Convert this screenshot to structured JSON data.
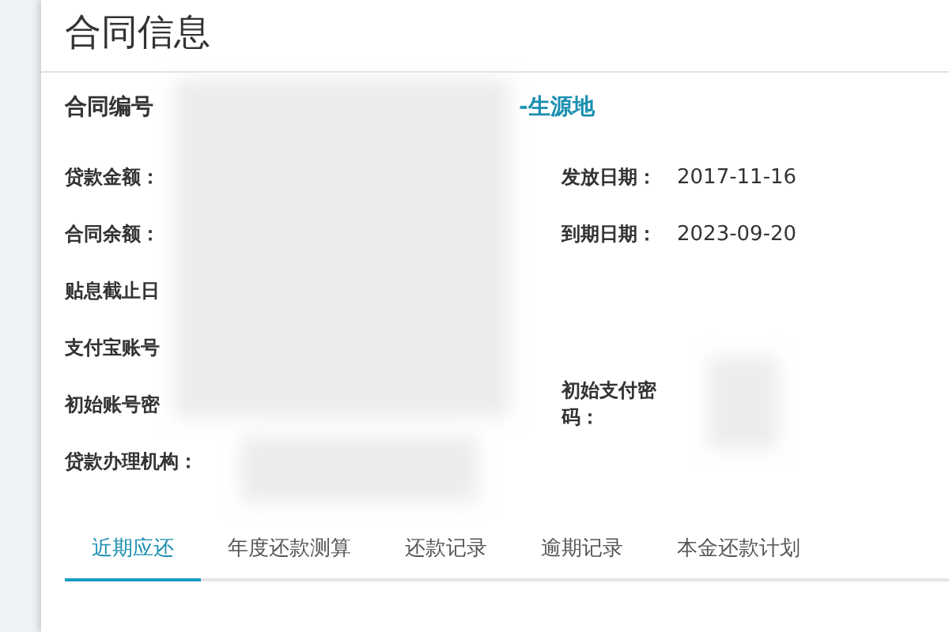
{
  "title": "合同信息",
  "contract": {
    "label": "合同编号",
    "suffix": "-生源地"
  },
  "rows": [
    {
      "left": {
        "label": "贷款金额："
      },
      "right": {
        "label": "发放日期：",
        "value": "2017-11-16"
      }
    },
    {
      "left": {
        "label": "合同余额："
      },
      "right": {
        "label": "到期日期：",
        "value": "2023-09-20"
      }
    },
    {
      "left": {
        "label": "贴息截止日"
      }
    },
    {
      "left": {
        "label": "支付宝账号"
      }
    },
    {
      "left": {
        "label": "初始账号密"
      },
      "right": {
        "label": "初始支付密码："
      }
    },
    {
      "left": {
        "label": "贷款办理机构："
      }
    }
  ],
  "tabs": [
    {
      "label": "近期应还",
      "selected": true
    },
    {
      "label": "年度还款测算",
      "selected": false
    },
    {
      "label": "还款记录",
      "selected": false
    },
    {
      "label": "逾期记录",
      "selected": false
    },
    {
      "label": "本金还款计划",
      "selected": false
    }
  ]
}
